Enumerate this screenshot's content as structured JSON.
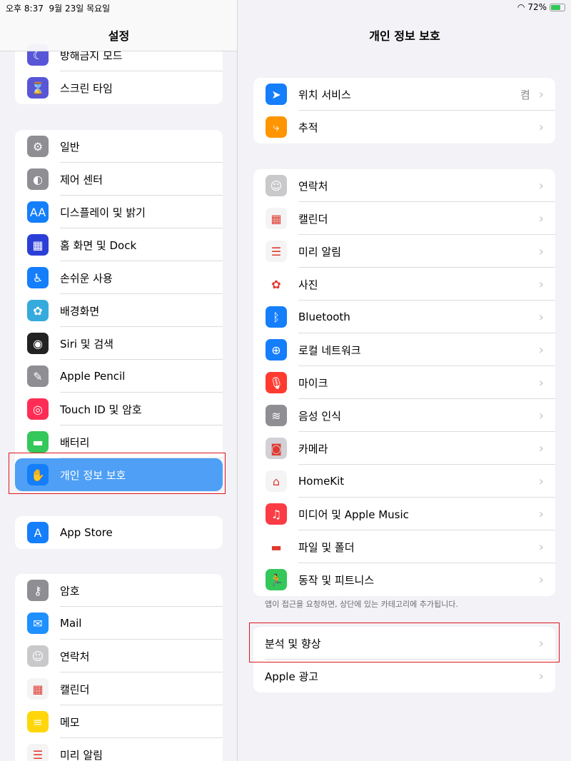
{
  "status": {
    "time": "오후 8:37",
    "date": "9월 23일 목요일",
    "battery": "72%",
    "battery_level": 72
  },
  "left": {
    "title": "설정",
    "groups": [
      [
        {
          "label": "방해금지 모드",
          "icon": "moon-icon",
          "color": "#5856d6",
          "g": "☾"
        },
        {
          "label": "스크린 타임",
          "icon": "hourglass-icon",
          "color": "#5856d6",
          "g": "⌛"
        }
      ],
      [
        {
          "label": "일반",
          "icon": "gear-icon",
          "color": "#8e8e93",
          "g": "⚙"
        },
        {
          "label": "제어 센터",
          "icon": "toggles-icon",
          "color": "#8e8e93",
          "g": "◐"
        },
        {
          "label": "디스플레이 및 밝기",
          "icon": "text-size-icon",
          "color": "#147efb",
          "g": "AA"
        },
        {
          "label": "홈 화면 및 Dock",
          "icon": "home-grid-icon",
          "color": "#2b3fd6",
          "g": "▦"
        },
        {
          "label": "손쉬운 사용",
          "icon": "accessibility-icon",
          "color": "#147efb",
          "g": "♿"
        },
        {
          "label": "배경화면",
          "icon": "flower-icon",
          "color": "#35aadc",
          "g": "✿"
        },
        {
          "label": "Siri 및 검색",
          "icon": "siri-icon",
          "color": "#222",
          "g": "◉"
        },
        {
          "label": "Apple Pencil",
          "icon": "pencil-icon",
          "color": "#8e8e93",
          "g": "✎"
        },
        {
          "label": "Touch ID 및 암호",
          "icon": "fingerprint-icon",
          "color": "#ff2d55",
          "g": "◎"
        },
        {
          "label": "배터리",
          "icon": "battery-icon",
          "color": "#34c759",
          "g": "▬"
        },
        {
          "label": "개인 정보 보호",
          "icon": "hand-icon",
          "color": "#147efb",
          "g": "✋",
          "selected": true
        }
      ],
      [
        {
          "label": "App Store",
          "icon": "app-store-icon",
          "color": "#147efb",
          "g": "A"
        }
      ],
      [
        {
          "label": "암호",
          "icon": "key-icon",
          "color": "#8e8e93",
          "g": "⚷"
        },
        {
          "label": "Mail",
          "icon": "mail-icon",
          "color": "#1e90ff",
          "g": "✉"
        },
        {
          "label": "연락처",
          "icon": "contacts-icon",
          "color": "#c9c9cc",
          "g": "☺"
        },
        {
          "label": "캘린더",
          "icon": "calendar-icon",
          "color": "#f4f4f4",
          "g": "▦",
          "dark": true
        },
        {
          "label": "메모",
          "icon": "notes-icon",
          "color": "#ffd60a",
          "g": "≡"
        },
        {
          "label": "미리 알림",
          "icon": "reminders-icon",
          "color": "#f4f4f4",
          "g": "☰",
          "dark": true
        }
      ]
    ]
  },
  "right": {
    "title": "개인 정보 보호",
    "groups": [
      [
        {
          "label": "위치 서비스",
          "icon": "location-arrow-icon",
          "color": "#147efb",
          "g": "➤",
          "value": "켬"
        },
        {
          "label": "추적",
          "icon": "tracking-icon",
          "color": "#ff9500",
          "g": "⤷"
        }
      ],
      [
        {
          "label": "연락처",
          "icon": "contacts-icon",
          "color": "#c9c9cc",
          "g": "☺"
        },
        {
          "label": "캘린더",
          "icon": "calendar-icon",
          "color": "#f4f4f4",
          "g": "▦",
          "dark": true
        },
        {
          "label": "미리 알림",
          "icon": "reminders-icon",
          "color": "#f4f4f4",
          "g": "☰",
          "dark": true
        },
        {
          "label": "사진",
          "icon": "photos-icon",
          "color": "#fff",
          "g": "✿",
          "dark": true
        },
        {
          "label": "Bluetooth",
          "icon": "bluetooth-icon",
          "color": "#147efb",
          "g": "ᛒ"
        },
        {
          "label": "로컬 네트워크",
          "icon": "globe-icon",
          "color": "#147efb",
          "g": "⊕"
        },
        {
          "label": "마이크",
          "icon": "microphone-icon",
          "color": "#ff3b30",
          "g": "🎙"
        },
        {
          "label": "음성 인식",
          "icon": "waveform-icon",
          "color": "#8e8e93",
          "g": "≋"
        },
        {
          "label": "카메라",
          "icon": "camera-icon",
          "color": "#d1d1d6",
          "g": "◙",
          "dark": true
        },
        {
          "label": "HomeKit",
          "icon": "home-icon",
          "color": "#f4f4f4",
          "g": "⌂",
          "dark": true
        },
        {
          "label": "미디어 및 Apple Music",
          "icon": "music-note-icon",
          "color": "#fc3c44",
          "g": "♫"
        },
        {
          "label": "파일 및 폴더",
          "icon": "folder-icon",
          "color": "#fff",
          "g": "▬",
          "dark": true
        },
        {
          "label": "동작 및 피트니스",
          "icon": "fitness-icon",
          "color": "#34c759",
          "g": "🏃"
        }
      ],
      [
        {
          "label": "분석 및 향상"
        },
        {
          "label": "Apple 광고"
        }
      ]
    ],
    "footer": "앱이 접근을 요청하면, 상단에 있는 카테고리에 추가됩니다."
  }
}
